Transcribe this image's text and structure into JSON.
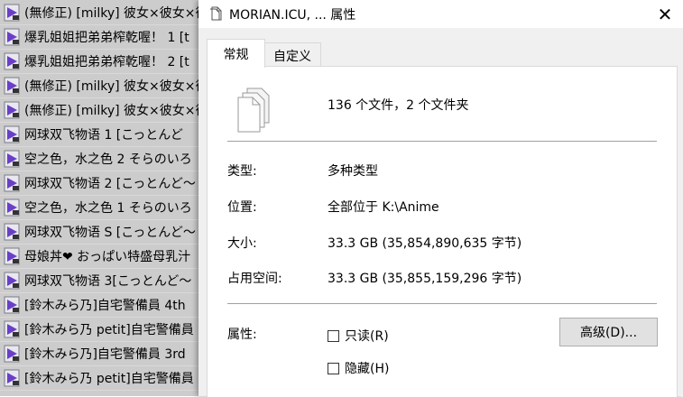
{
  "file_list": {
    "items": [
      {
        "label": "(無修正) [milky] 彼女×彼女×彼女",
        "icon": "video-file-icon"
      },
      {
        "label": "爆乳姐姐把弟弟榨乾喔！ 1 [t",
        "icon": "video-file-icon"
      },
      {
        "label": "爆乳姐姐把弟弟榨乾喔！ 2 [t",
        "icon": "video-file-icon"
      },
      {
        "label": "(無修正) [milky] 彼女×彼女×彼女",
        "icon": "video-file-icon"
      },
      {
        "label": "(無修正) [milky] 彼女×彼女×彼女",
        "icon": "video-file-icon"
      },
      {
        "label": "网球双飞物语 1 [こっとんど",
        "icon": "video-file-icon"
      },
      {
        "label": "空之色，水之色 2 そらのいろ",
        "icon": "video-file-icon"
      },
      {
        "label": "网球双飞物语 2 [こっとんど～",
        "icon": "video-file-icon"
      },
      {
        "label": "空之色，水之色 1 そらのいろ",
        "icon": "video-file-icon"
      },
      {
        "label": "网球双飞物语 S [こっとんど～",
        "icon": "video-file-icon"
      },
      {
        "label": "母娘丼❤ おっぱい特盛母乳汁",
        "icon": "video-file-icon"
      },
      {
        "label": "网球双飞物语 3[こっとんど～",
        "icon": "video-file-icon"
      },
      {
        "label": "[鈴木みら乃]自宅警備員 4th",
        "icon": "video-file-icon"
      },
      {
        "label": "[鈴木みら乃 petit]自宅警備員",
        "icon": "video-file-icon"
      },
      {
        "label": "[鈴木みら乃]自宅警備員 3rd",
        "icon": "video-file-icon"
      },
      {
        "label": "[鈴木みら乃 petit]自宅警備員",
        "icon": "video-file-icon"
      }
    ]
  },
  "dialog": {
    "title": "MORIAN.ICU, ... 属性",
    "close_glyph": "✕",
    "tabs": {
      "general": "常规",
      "custom": "自定义"
    },
    "summary": "136 个文件，2 个文件夹",
    "properties": {
      "type_label": "类型:",
      "type_value": "多种类型",
      "location_label": "位置:",
      "location_value": "全部位于 K:\\Anime",
      "size_label": "大小:",
      "size_value": "33.3 GB (35,854,890,635 字节)",
      "disk_label": "占用空间:",
      "disk_value": "33.3 GB (35,855,159,296 字节)"
    },
    "attributes": {
      "label": "属性:",
      "readonly": "只读(R)",
      "hidden": "隐藏(H)",
      "advanced_button": "高级(D)..."
    }
  },
  "colors": {
    "list_bg": "#cccccc",
    "dialog_bg": "#f0f0f0",
    "video_icon_purple": "#6a3fc8"
  }
}
